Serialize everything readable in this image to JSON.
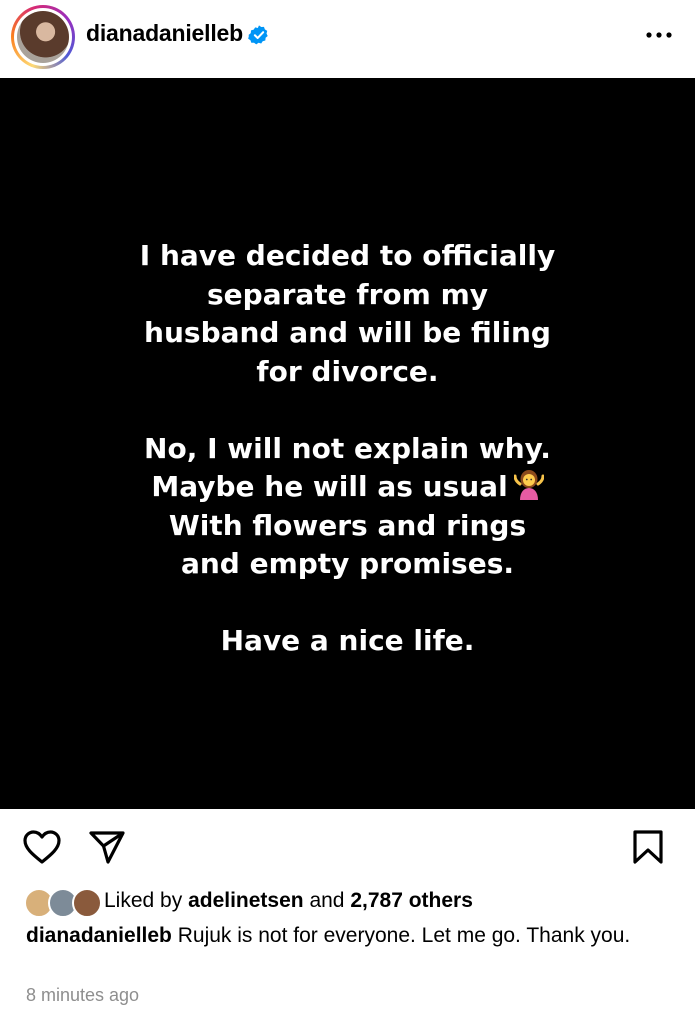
{
  "header": {
    "username": "dianadanielleb",
    "verified_icon": "verified-badge-icon",
    "more_icon": "more-options-icon"
  },
  "post": {
    "lines": [
      "I have decided to officially",
      "separate from my",
      "husband and will be filing",
      "for divorce.",
      "",
      "No, I will not explain why.",
      "Maybe he will as usual",
      "With flowers and rings",
      "and empty promises.",
      "",
      "Have a nice life."
    ],
    "emoji": "shrugging-woman-emoji"
  },
  "actions": {
    "icons": [
      "heart-icon",
      "share-icon",
      "bookmark-icon"
    ]
  },
  "likes": {
    "prefix": "Liked by",
    "user": "adelinetsen",
    "middle": "and",
    "others": "2,787 others"
  },
  "caption": {
    "username": "dianadanielleb",
    "text": "Rujuk is not for everyone. Let me go. Thank you."
  },
  "time": "8 minutes ago",
  "colors": {
    "verified": "#0095f6",
    "muted": "#8e8e8e",
    "post_bg": "#000000"
  }
}
